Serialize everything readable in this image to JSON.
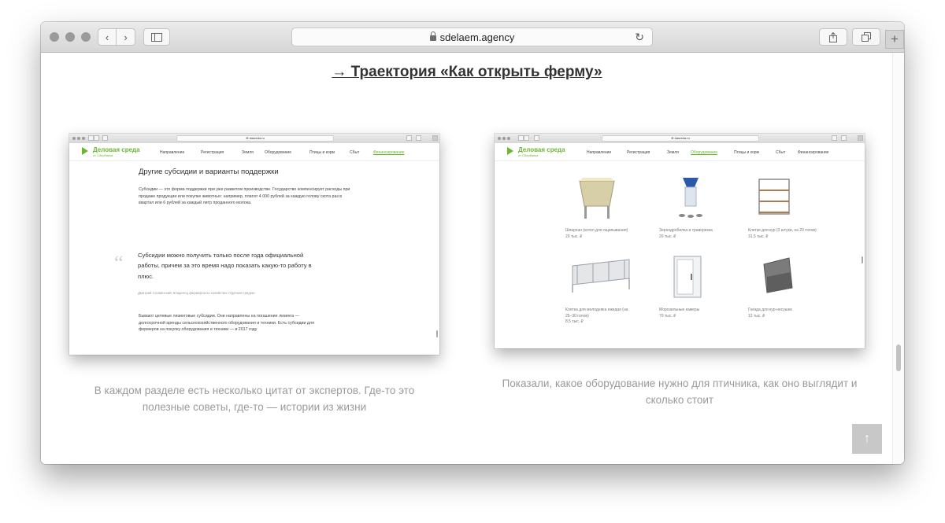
{
  "browser": {
    "url": "sdelaem.agency"
  },
  "page": {
    "heading": "→ Траектория «Как открыть ферму»",
    "caption_left": "В каждом разделе есть несколько цитат от экспертов. Где-то это полезные советы, где-то — истории из жизни",
    "caption_right": "Показали, какое оборудование нужно для птичника, как оно выглядит и сколько стоит",
    "to_top_glyph": "↑"
  },
  "shots": {
    "url": "⊕ dasreda.ru",
    "brand_name": "Деловая среда",
    "brand_sub": "от Сбербанка",
    "nav": [
      "Направление",
      "Регистрация",
      "Земля",
      "Оборудование",
      "Птицы и корм",
      "Сбыт",
      "Финансирование"
    ],
    "left": {
      "active_nav": "Финансирование",
      "title": "Другие субсидии и варианты поддержки",
      "para1": "Субсидии — это форма поддержки при уже развитом производстве. Государство компенсирует расходы при продаже продукции или покупке животных: например, платит 4 000 рублей за каждую голову скота раз в квартал или 6 рублей за каждый литр проданного молока.",
      "quote_mark": "“",
      "quote": "Субсидии можно получить только после года официальной работы, причем за это время надо показать какую-то работу в плюс.",
      "author": "Дмитрий Славинский, владелец фермерского хозяйства «Удачная грядка»",
      "para2": "Бывают целевые лизинговые субсидии. Они направлены на погашение лизинга — долгосрочной аренды сельскохозяйственного оборудования и техники. Есть субсидии для фермеров на покупку оборудования и техники — в 2017 году"
    },
    "right": {
      "active_nav": "Оборудование",
      "products": [
        {
          "name": "Шпарчан (котел для ощипывания)",
          "price": "20 тыс. ₽"
        },
        {
          "name": "Зернодробилка и траворезка",
          "price": "20 тыс. ₽"
        },
        {
          "name": "Клетки для кур (3 штуки, на 20 голов)",
          "price": "31,5 тыс. ₽"
        },
        {
          "name": "Клетка для молодняка ежедая (на 25–30 голов)",
          "price": "8,5 тыс. ₽"
        },
        {
          "name": "Морозильные камеры",
          "price": "70 тыс. ₽"
        },
        {
          "name": "Гнезда для кур-несушек",
          "price": "12 тыс. ₽"
        }
      ]
    }
  }
}
